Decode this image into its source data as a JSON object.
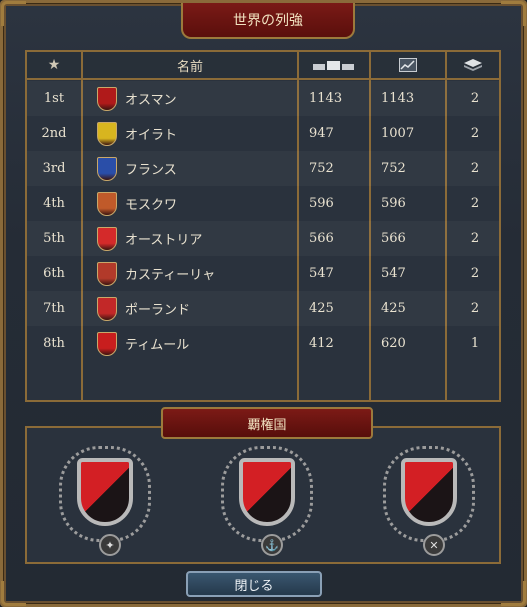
{
  "window": {
    "title": "世界の列強"
  },
  "table": {
    "headers": {
      "name": "名前"
    },
    "rows": [
      {
        "rank": "1st",
        "name": "オスマン",
        "v1": "1143",
        "v2": "1143",
        "v3": "2",
        "shield": "#b01a1a"
      },
      {
        "rank": "2nd",
        "name": "オイラト",
        "v1": "947",
        "v2": "1007",
        "v3": "2",
        "shield": "#d8b51f"
      },
      {
        "rank": "3rd",
        "name": "フランス",
        "v1": "752",
        "v2": "752",
        "v3": "2",
        "shield": "#2a4ea8"
      },
      {
        "rank": "4th",
        "name": "モスクワ",
        "v1": "596",
        "v2": "596",
        "v3": "2",
        "shield": "#c05a2a"
      },
      {
        "rank": "5th",
        "name": "オーストリア",
        "v1": "566",
        "v2": "566",
        "v3": "2",
        "shield": "#d42a2a"
      },
      {
        "rank": "6th",
        "name": "カスティーリャ",
        "v1": "547",
        "v2": "547",
        "v3": "2",
        "shield": "#b23a2a"
      },
      {
        "rank": "7th",
        "name": "ポーランド",
        "v1": "425",
        "v2": "425",
        "v3": "2",
        "shield": "#c22828"
      },
      {
        "rank": "8th",
        "name": "ティムール",
        "v1": "412",
        "v2": "620",
        "v3": "1",
        "shield": "#c81e1e"
      }
    ]
  },
  "hegemony": {
    "title": "覇権国"
  },
  "close_button": {
    "label": "閉じる"
  }
}
